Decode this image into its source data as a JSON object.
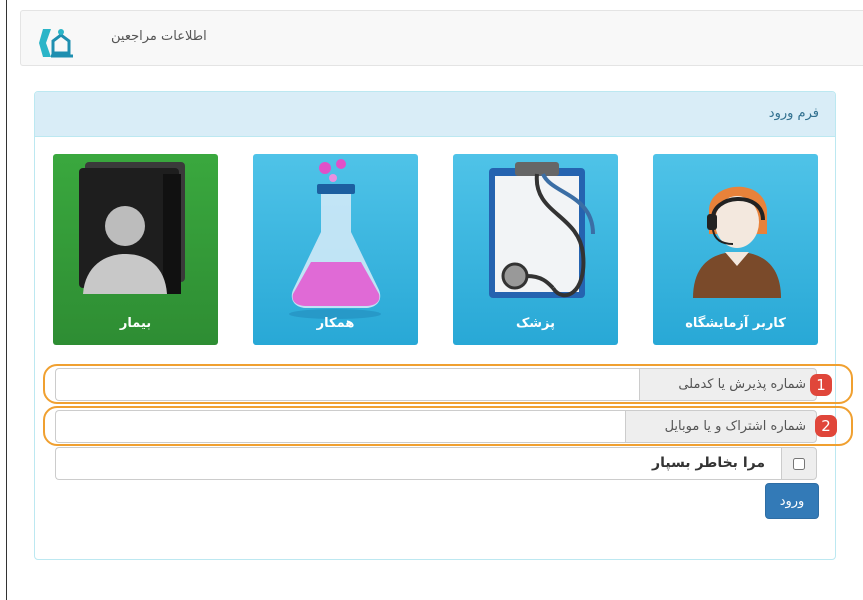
{
  "navbar": {
    "brand": "اطلاعات مراجعین",
    "logo_icon": "clinic-logo-icon"
  },
  "panel": {
    "title": "فرم ورود",
    "heading_color": "#d9edf7",
    "tiles": [
      {
        "label": "کاربر آزمایشگاه",
        "icon": "lab-operator-icon",
        "color": "#3bb6e0"
      },
      {
        "label": "پزشک",
        "icon": "clipboard-stethoscope-icon",
        "color": "#3bb6e0"
      },
      {
        "label": "همکار",
        "icon": "flask-icon",
        "color": "#3bb6e0"
      },
      {
        "label": "بیمار",
        "icon": "patient-folder-icon",
        "color": "#34a038"
      }
    ],
    "fields": [
      {
        "addon": "شماره پذیرش یا کدملی",
        "value": "",
        "marker": "1"
      },
      {
        "addon": "شماره اشتراک و یا موبایل",
        "value": "",
        "marker": "2"
      }
    ],
    "remember_label": "مرا بخاطر بسپار",
    "submit_label": "ورود",
    "highlight_color": "#f0a030",
    "marker_color": "#e0463a"
  }
}
